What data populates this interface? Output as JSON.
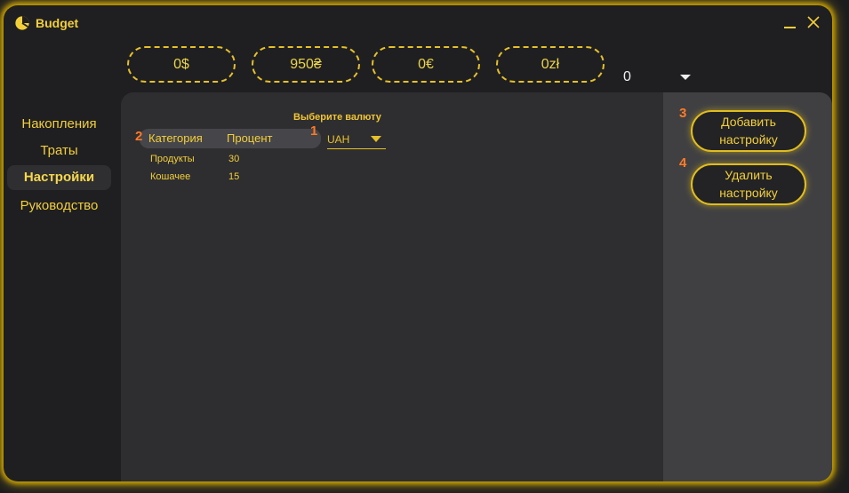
{
  "app": {
    "title": "Budget"
  },
  "balances": [
    {
      "value": "0$"
    },
    {
      "value": "950₴"
    },
    {
      "value": "0€"
    },
    {
      "value": "0zł"
    }
  ],
  "extra_balance": {
    "value": "0"
  },
  "sidebar": {
    "items": [
      {
        "label": "Накопления"
      },
      {
        "label": "Траты"
      },
      {
        "label": "Настройки",
        "active": true
      },
      {
        "label": "Руководство"
      }
    ]
  },
  "settings": {
    "currency_label": "Выберите валюту",
    "currency_value": "UAH",
    "table": {
      "headers": [
        "Категория",
        "Процент"
      ],
      "rows": [
        [
          "Продукты",
          "30"
        ],
        [
          "Кошачее",
          "15"
        ]
      ]
    }
  },
  "actions": {
    "add_label": "Добавить настройку",
    "delete_label": "Удалить настройку"
  },
  "markers": [
    "1",
    "2",
    "3",
    "4"
  ],
  "colors": {
    "accent": "#f3cf3a",
    "marker": "#ff7a24",
    "background": "#1f1f21"
  }
}
